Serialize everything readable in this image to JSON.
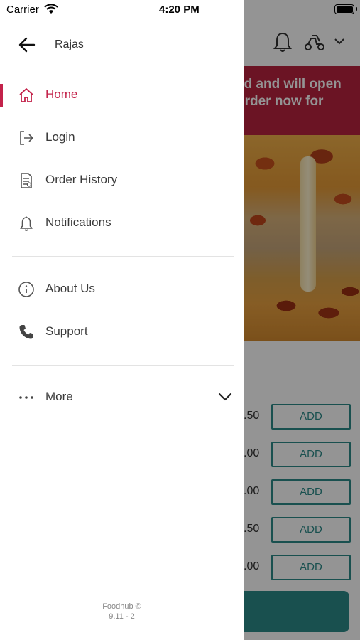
{
  "status_bar": {
    "carrier": "Carrier",
    "time": "4:20 PM"
  },
  "drawer": {
    "user_name": "Rajas",
    "menu_primary": [
      {
        "label": "Home",
        "icon": "home-icon",
        "active": true
      },
      {
        "label": "Login",
        "icon": "login-icon",
        "active": false
      },
      {
        "label": "Order History",
        "icon": "order-history-icon",
        "active": false
      },
      {
        "label": "Notifications",
        "icon": "bell-icon",
        "active": false
      }
    ],
    "menu_secondary": [
      {
        "label": "About Us",
        "icon": "info-icon"
      },
      {
        "label": "Support",
        "icon": "phone-icon"
      }
    ],
    "more": {
      "label": "More",
      "icon": "more-dots-icon"
    },
    "footer": {
      "line1": "Foodhub ©",
      "line2": "9.11 - 2"
    },
    "accent_color": "#c3224a"
  },
  "background_screen": {
    "banner_lines": [
      "ed and will open",
      "order now for"
    ],
    "prices": [
      ".50",
      ".00",
      ".00",
      ".50",
      ".00"
    ],
    "add_label": "ADD",
    "brand_color": "#2b8a89",
    "banner_color": "#b8243f"
  }
}
